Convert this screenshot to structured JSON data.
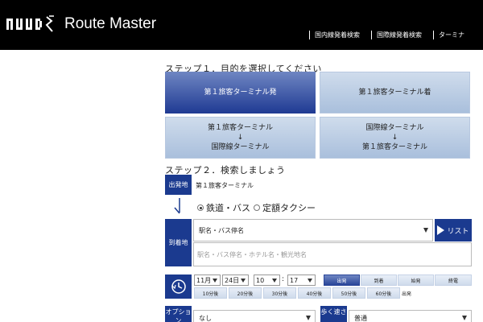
{
  "header": {
    "logo_text": "Route Master",
    "nav": [
      "国内線発着検索",
      "国際線発着検索",
      "ターミナ"
    ]
  },
  "step1": {
    "title": "ステップ１．目的を選択してください",
    "choices": [
      {
        "lines": [
          "第１旅客ターミナル発"
        ],
        "active": true
      },
      {
        "lines": [
          "第１旅客ターミナル着"
        ],
        "active": false
      },
      {
        "lines": [
          "第１旅客ターミナル",
          "↓",
          "国際線ターミナル"
        ],
        "active": false
      },
      {
        "lines": [
          "国際線ターミナル",
          "↓",
          "第１旅客ターミナル"
        ],
        "active": false
      }
    ]
  },
  "step2": {
    "title": "ステップ２．検索しましょう",
    "departure_label": "出発地",
    "departure_value": "第１旅客ターミナル",
    "modes": [
      {
        "label": "鉄道・バス",
        "checked": true
      },
      {
        "label": "定額タクシー",
        "checked": false
      }
    ],
    "arrival_label": "到着地",
    "arrival_select": "駅名・バス停名",
    "list_button": "リスト",
    "arrival_placeholder": "駅名・バス停名・ホテル名・観光地名",
    "datetime": {
      "month": "11月",
      "day": "24日",
      "hour": "10",
      "minute": "17",
      "colon": ":",
      "tabs": [
        "出発",
        "到着",
        "始発",
        "終電"
      ],
      "active_tab": "出発",
      "offsets": [
        "10分後",
        "20分後",
        "30分後",
        "40分後",
        "50分後",
        "60分後"
      ],
      "suffix": "出発"
    },
    "option_label": "オプション",
    "option_value": "なし",
    "walk_label": "歩く速さ",
    "walk_value": "普通"
  },
  "colors": {
    "header_bg": "#000000",
    "accent": "#1b3a8f",
    "active_button": "#2a4699",
    "inactive_button": "#b9cbe4"
  }
}
